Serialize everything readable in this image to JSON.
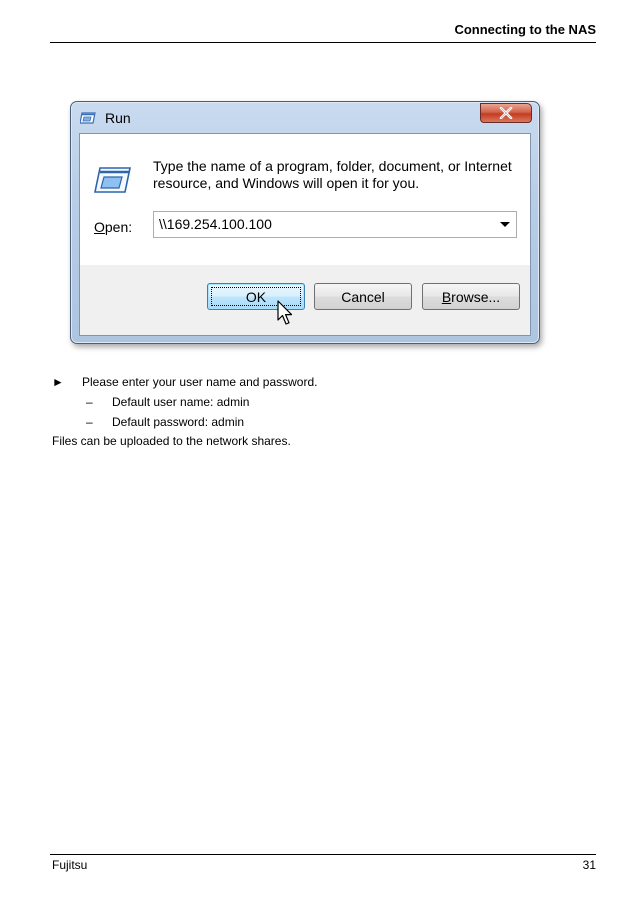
{
  "header": {
    "title": "Connecting to the NAS"
  },
  "dialog": {
    "title": "Run",
    "description": "Type the name of a program, folder, document, or Internet resource, and Windows will open it for you.",
    "open_label_accel": "O",
    "open_label_rest": "pen:",
    "open_value": "\\\\169.254.100.100",
    "ok_label": "OK",
    "cancel_label": "Cancel",
    "browse_accel": "B",
    "browse_rest": "rowse..."
  },
  "body": {
    "bullet_symbol": "►",
    "bullet_text": "Please enter your user name and password.",
    "dash": "–",
    "items": [
      "Default user name: admin",
      "Default password: admin"
    ],
    "paragraph": "Files can be uploaded to the network shares."
  },
  "footer": {
    "brand": "Fujitsu",
    "page_number": "31"
  },
  "colors": {
    "titlebar": "#b8cde6",
    "close_button": "#c23d22",
    "ok_button_border": "#3c7fb1"
  }
}
